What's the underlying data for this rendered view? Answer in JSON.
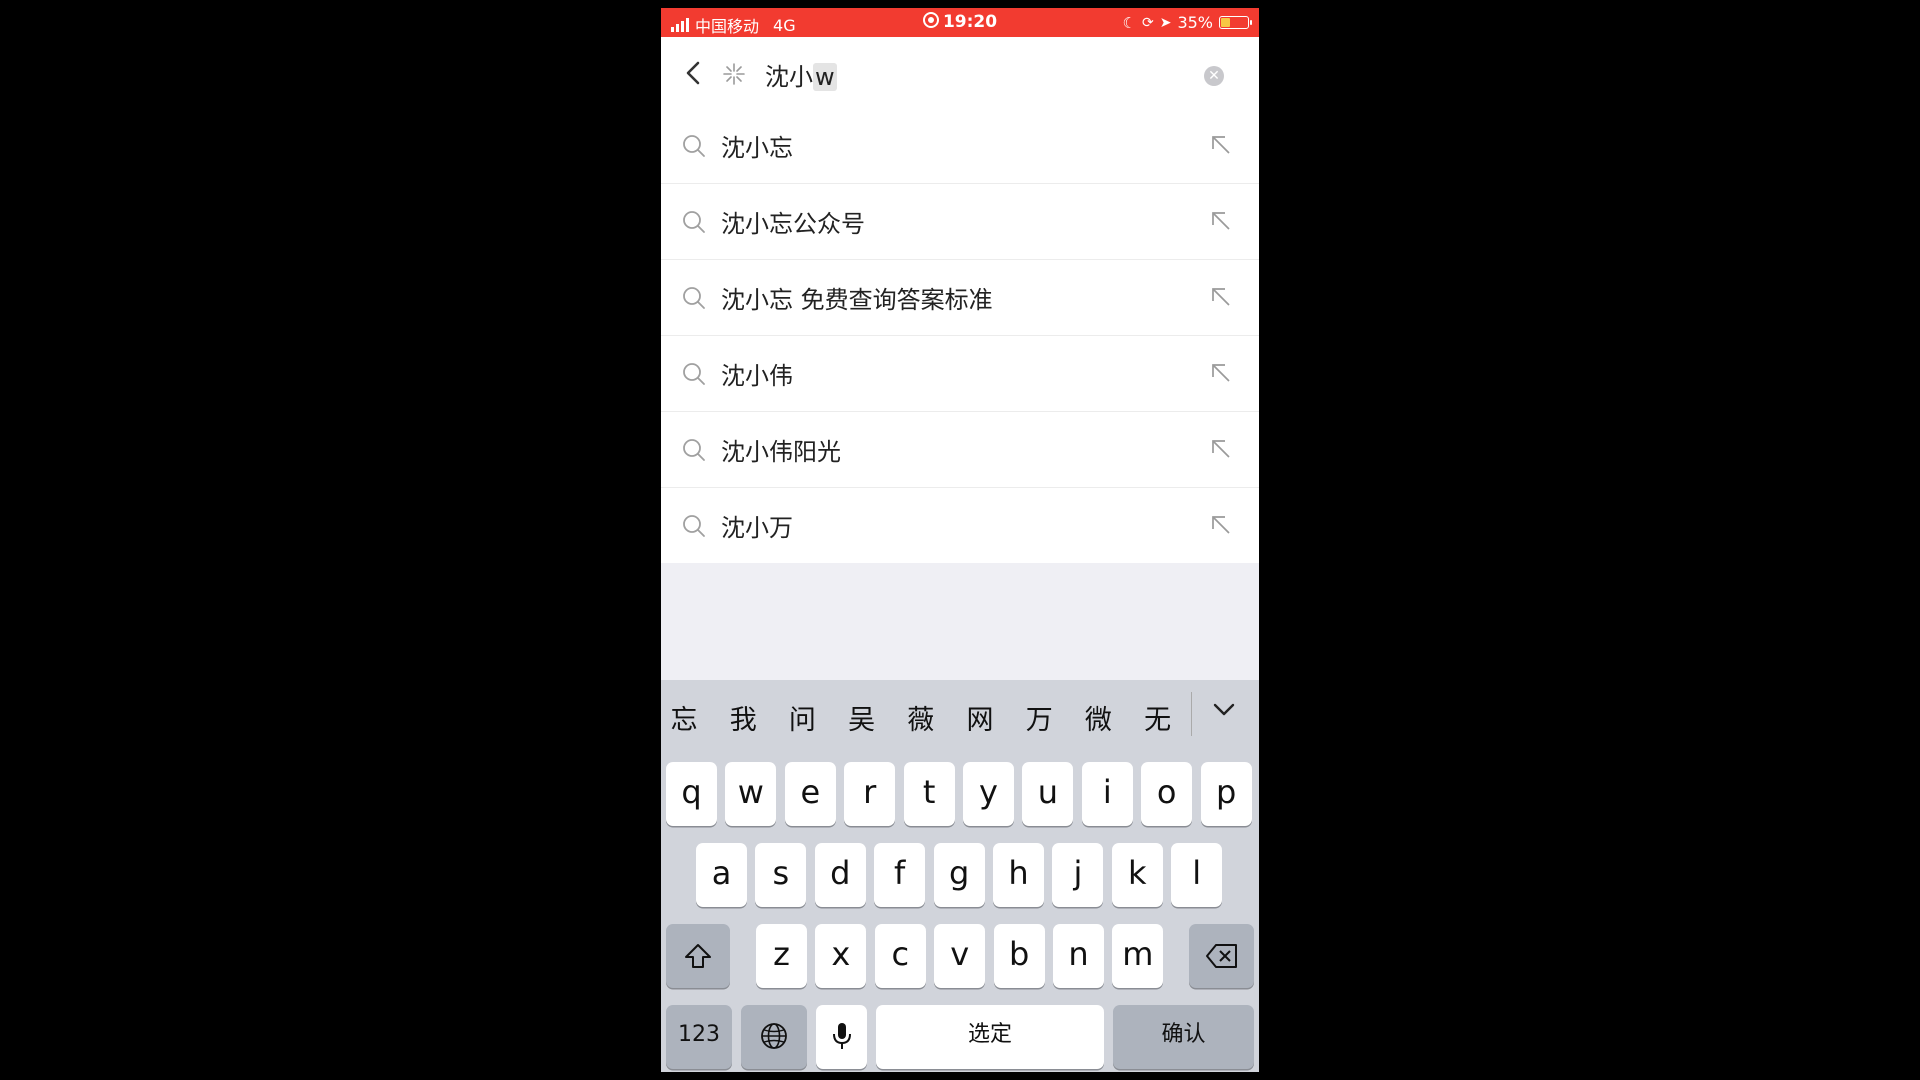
{
  "status_bar": {
    "carrier": "中国移动",
    "network": "4G",
    "time": "19:20",
    "battery": "35%",
    "battery_level": 0.35
  },
  "search": {
    "query_committed": "沈小",
    "query_composing": "w"
  },
  "suggestions": [
    {
      "text": "沈小忘"
    },
    {
      "text": "沈小忘公众号"
    },
    {
      "text": "沈小忘 免费查询答案标准"
    },
    {
      "text": "沈小伟"
    },
    {
      "text": "沈小伟阳光"
    },
    {
      "text": "沈小万"
    }
  ],
  "keyboard": {
    "candidates": [
      "忘",
      "我",
      "问",
      "吴",
      "薇",
      "网",
      "万",
      "微",
      "无"
    ],
    "row1": [
      "q",
      "w",
      "e",
      "r",
      "t",
      "y",
      "u",
      "i",
      "o",
      "p"
    ],
    "row2": [
      "a",
      "s",
      "d",
      "f",
      "g",
      "h",
      "j",
      "k",
      "l"
    ],
    "row3": [
      "z",
      "x",
      "c",
      "v",
      "b",
      "n",
      "m"
    ],
    "numbers_label": "123",
    "space_label": "选定",
    "confirm_label": "确认"
  },
  "colors": {
    "status_bar": "#f23b30",
    "keyboard_bg": "#d1d4db"
  }
}
